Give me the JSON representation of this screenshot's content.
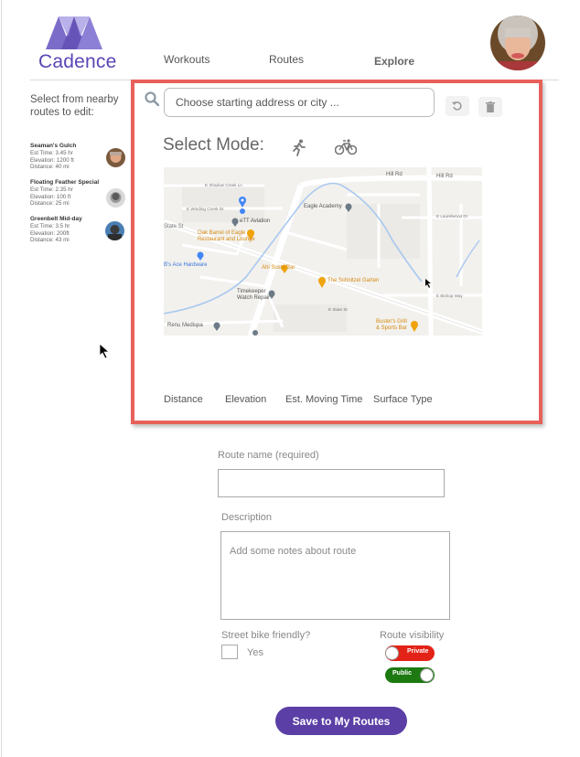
{
  "app": {
    "name": "Cadence",
    "brand_color": "#5b45b5",
    "accent_red": "#e8605a"
  },
  "nav": {
    "items": [
      {
        "label": "Workouts"
      },
      {
        "label": "Routes"
      },
      {
        "label": "Explore"
      }
    ]
  },
  "sidebar": {
    "title": "Select from nearby routes to edit:",
    "routes": [
      {
        "name": "Seaman's Gulch",
        "time": "Est Time: 3.45 hr",
        "elevation": "Elevation: 1200 ft",
        "distance": "Distance: 40 mi"
      },
      {
        "name": "Floating Feather Special",
        "time": "Est Time: 2.35 hr",
        "elevation": "Elevation: 100 ft",
        "distance": "Distance: 25 mi"
      },
      {
        "name": "Greenbelt Mid-day",
        "time": "Est Time:  3.5 hr",
        "elevation": "Elevation: 200ft",
        "distance": "Distance: 43 mi"
      }
    ]
  },
  "planner": {
    "search_placeholder": "Choose starting address or city ...",
    "mode_label": "Select Mode:",
    "modes": [
      {
        "icon": "running-icon"
      },
      {
        "icon": "bicycle-icon"
      }
    ],
    "map": {
      "places": {
        "hill_rd": "Hill Rd",
        "hill_rd_2": "Hill Rd",
        "shadow_creek": "E Shadow Creek Ln",
        "winding_creek": "E Winding Creek Dr",
        "state_st_w": "State St",
        "ett_aviation": "eTT Aviation",
        "eagle_academy": "Eagle Academy",
        "oak_barrel": "Oak Barrel of Eagle\nRestaurant and Lounge",
        "ace_hardware": "B's Ace Hardware",
        "ahi_sushi": "Ahi Sushi Bar",
        "schnitzel": "The Schnitzel Garten",
        "timekeeper": "Timekeeper\nWatch Repair",
        "renu": "Renu Medispa",
        "busters": "Buster's Grill\n& Sports Bar",
        "state_st_e": "E State St",
        "bishop": "E Bishop Way",
        "laurelwood": "E Laurelwood Dr"
      }
    },
    "stats": {
      "distance": "Distance",
      "elevation": "Elevation",
      "moving_time": "Est. Moving Time",
      "surface": "Surface Type"
    }
  },
  "form": {
    "route_name_label": "Route name (required)",
    "route_name_value": "",
    "description_label": "Description",
    "description_placeholder": "Add some notes about route",
    "bike_friendly_label": "Street bike friendly?",
    "bike_friendly_option": "Yes",
    "visibility_label": "Route visibility",
    "toggle_private": "Private",
    "toggle_public": "Public",
    "save_label": "Save to My Routes"
  }
}
